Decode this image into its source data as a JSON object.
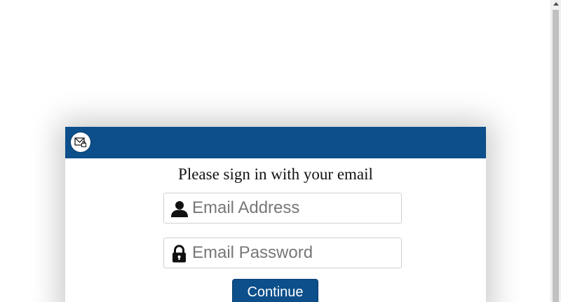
{
  "modal": {
    "header_icon": "mail-lock-icon",
    "title": "Please sign in with your email",
    "email_field": {
      "icon": "user-icon",
      "placeholder": "Email Address",
      "value": ""
    },
    "password_field": {
      "icon": "lock-icon",
      "placeholder": "Email Password",
      "value": ""
    },
    "continue_label": "Continue"
  },
  "colors": {
    "header_bg": "#0c4f8a",
    "button_bg": "#0c4f8a",
    "button_text": "#ffffff",
    "page_bg": "#ffffff"
  }
}
